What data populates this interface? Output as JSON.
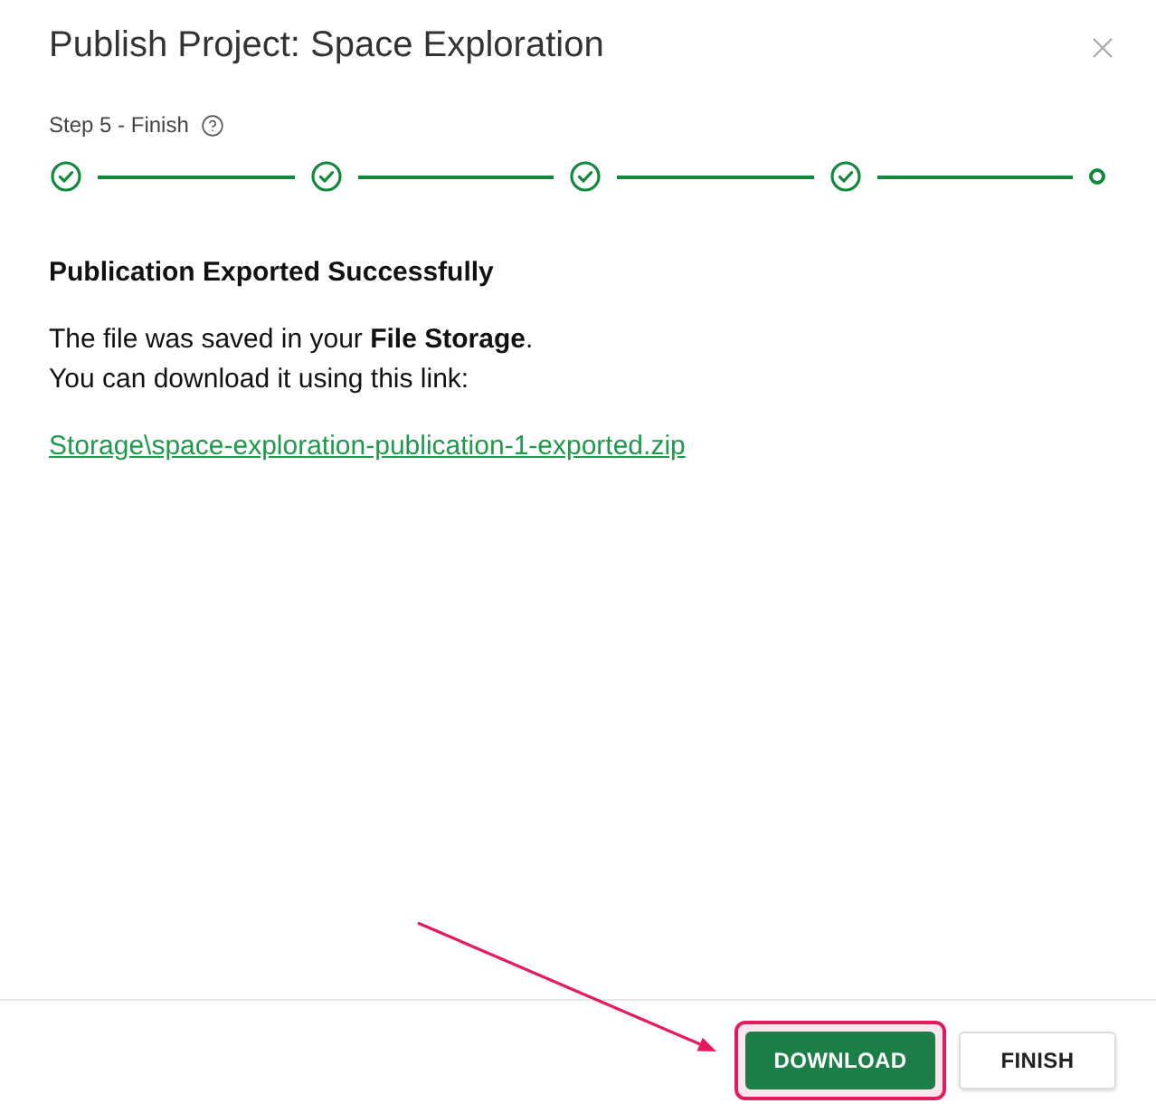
{
  "dialog": {
    "title": "Publish Project: Space Exploration",
    "step_label": "Step 5 - Finish"
  },
  "steps": [
    {
      "completed": true
    },
    {
      "completed": true
    },
    {
      "completed": true
    },
    {
      "completed": true
    },
    {
      "completed": false
    }
  ],
  "message": {
    "heading": "Publication Exported Successfully",
    "lines": [
      "The file was saved in your **File Storage**.",
      "You can download it using this link:"
    ],
    "link": "Storage\\space-exploration-publication-1-exported.zip"
  },
  "buttons": [
    {
      "label": "DOWNLOAD",
      "kind": "primary",
      "highlighted": true
    },
    {
      "label": "FINISH",
      "kind": "secondary",
      "highlighted": false
    }
  ],
  "annotation": {
    "kind": "arrow"
  }
}
